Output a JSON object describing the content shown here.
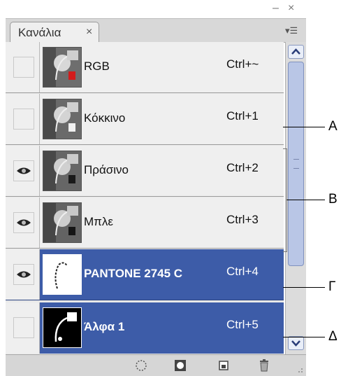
{
  "window": {
    "minimize_glyph": "–",
    "close_glyph": "×"
  },
  "tab": {
    "label": "Κανάλια",
    "close_glyph": "×"
  },
  "panel_menu": {
    "glyph": "▾☰"
  },
  "channels": [
    {
      "name": "RGB",
      "shortcut": "Ctrl+~",
      "visible": false,
      "selected": false
    },
    {
      "name": "Κόκκινο",
      "shortcut": "Ctrl+1",
      "visible": false,
      "selected": false
    },
    {
      "name": "Πράσινο",
      "shortcut": "Ctrl+2",
      "visible": true,
      "selected": false
    },
    {
      "name": "Μπλε",
      "shortcut": "Ctrl+3",
      "visible": true,
      "selected": false
    },
    {
      "name": "PANTONE 2745 C",
      "shortcut": "Ctrl+4",
      "visible": true,
      "selected": true
    },
    {
      "name": "Άλφα 1",
      "shortcut": "Ctrl+5",
      "visible": false,
      "selected": true
    }
  ],
  "footer_icons": [
    "load-selection-icon",
    "save-selection-icon",
    "new-channel-icon",
    "delete-icon"
  ],
  "callouts": {
    "a": "A",
    "b": "B",
    "g": "Γ",
    "d": "Δ"
  },
  "colors": {
    "selected": "#3d5ca8",
    "row": "#efefef",
    "scroll_thumb": "#b9c6e6"
  }
}
